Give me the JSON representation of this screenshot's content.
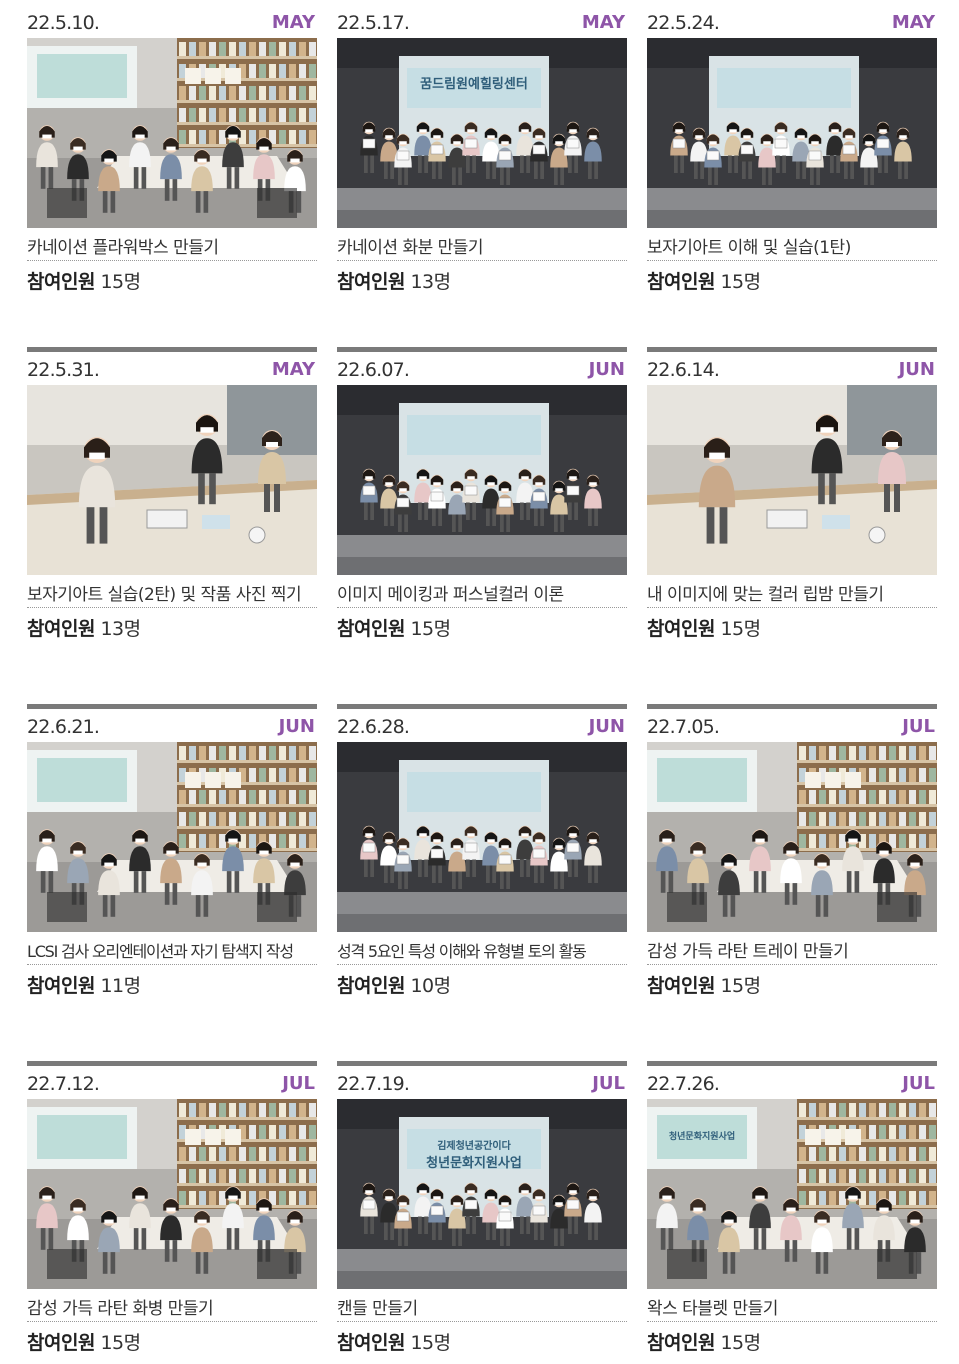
{
  "sessions": [
    {
      "date": "22.5.10.",
      "month": "MAY",
      "title": "카네이션 플라워박스 만들기",
      "label": "참여인원",
      "count": "15명",
      "scene": "classroom"
    },
    {
      "date": "22.5.17.",
      "month": "MAY",
      "title": "카네이션 화분 만들기",
      "label": "참여인원",
      "count": "13명",
      "scene": "group",
      "screen_text": [
        "꿈드림원예힐링센터"
      ]
    },
    {
      "date": "22.5.24.",
      "month": "MAY",
      "title": "보자기아트 이해 및 실습(1탄)",
      "label": "참여인원",
      "count": "15명",
      "scene": "group"
    },
    {
      "date": "22.5.31.",
      "month": "MAY",
      "title": "보자기아트 실습(2탄) 및 작품 사진 찍기",
      "label": "참여인원",
      "count": "13명",
      "scene": "workshop"
    },
    {
      "date": "22.6.07.",
      "month": "JUN",
      "title": "이미지 메이킹과 퍼스널컬러 이론",
      "label": "참여인원",
      "count": "15명",
      "scene": "group"
    },
    {
      "date": "22.6.14.",
      "month": "JUN",
      "title": "내 이미지에 맞는 컬러 립밤 만들기",
      "label": "참여인원",
      "count": "15명",
      "scene": "workshop"
    },
    {
      "date": "22.6.21.",
      "month": "JUN",
      "title": "LCSI 검사 오리엔테이션과 자기 탐색지 작성",
      "label": "참여인원",
      "count": "11명",
      "scene": "classroom"
    },
    {
      "date": "22.6.28.",
      "month": "JUN",
      "title": "성격 5요인 특성 이해와 유형별 토의 활동",
      "label": "참여인원",
      "count": "10명",
      "scene": "group"
    },
    {
      "date": "22.7.05.",
      "month": "JUL",
      "title": "감성 가득 라탄 트레이 만들기",
      "label": "참여인원",
      "count": "15명",
      "scene": "classroom"
    },
    {
      "date": "22.7.12.",
      "month": "JUL",
      "title": "감성 가득 라탄 화병 만들기",
      "label": "참여인원",
      "count": "15명",
      "scene": "classroom"
    },
    {
      "date": "22.7.19.",
      "month": "JUL",
      "title": "캔들 만들기",
      "label": "참여인원",
      "count": "15명",
      "scene": "group",
      "screen_text": [
        "김제청년공간이다",
        "청년문화지원사업"
      ]
    },
    {
      "date": "22.7.26.",
      "month": "JUL",
      "title": "왁스 타블렛 만들기",
      "label": "참여인원",
      "count": "15명",
      "scene": "classroom",
      "screen_text": [
        "청년문화지원사업"
      ]
    }
  ],
  "colors": {
    "month": "#8e55a8",
    "rule": "#7a7a7a"
  }
}
